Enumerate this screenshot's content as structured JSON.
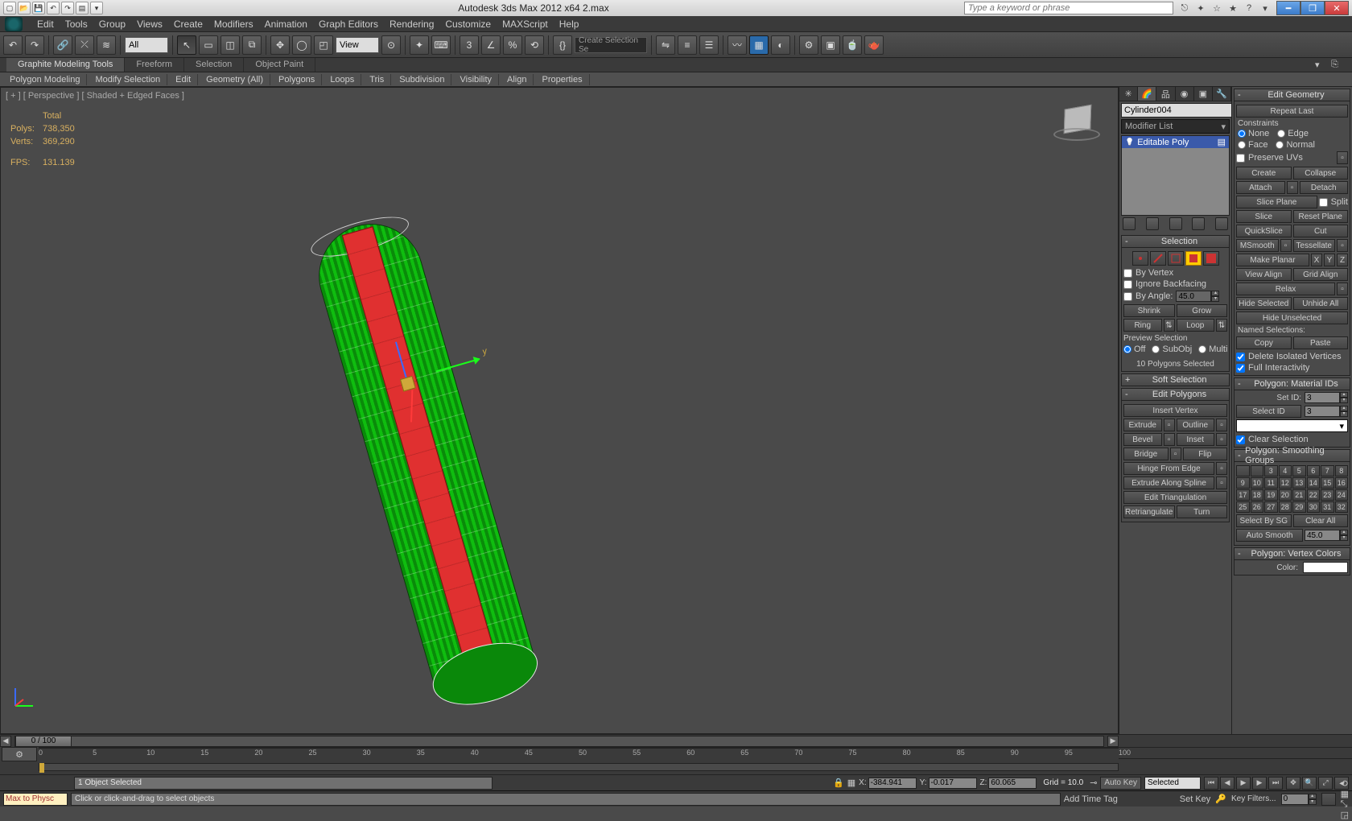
{
  "title": "Autodesk 3ds Max 2012 x64     2.max",
  "searchPlaceholder": "Type a keyword or phrase",
  "menu": [
    "Edit",
    "Tools",
    "Group",
    "Views",
    "Create",
    "Modifiers",
    "Animation",
    "Graph Editors",
    "Rendering",
    "Customize",
    "MAXScript",
    "Help"
  ],
  "maintool": {
    "selSet": "All",
    "refCoord": "View",
    "namedSel": "Create Selection Se"
  },
  "ribbonTabs": [
    "Graphite Modeling Tools",
    "Freeform",
    "Selection",
    "Object Paint"
  ],
  "ribbonSub": [
    "Polygon Modeling",
    "Modify Selection",
    "Edit",
    "Geometry (All)",
    "Polygons",
    "Loops",
    "Tris",
    "Subdivision",
    "Visibility",
    "Align",
    "Properties"
  ],
  "viewport": {
    "label": "[ + ] [ Perspective ] [ Shaded + Edged Faces ]",
    "stats": {
      "totalLabel": "Total",
      "polysLabel": "Polys:",
      "polys": "738,350",
      "vertsLabel": "Verts:",
      "verts": "369,290",
      "fpsLabel": "FPS:",
      "fps": "131.139"
    },
    "axisY": "y"
  },
  "cmd": {
    "objectName": "Cylinder004",
    "modListLabel": "Modifier List",
    "modItem": "Editable Poly",
    "selection": {
      "head": "Selection",
      "byVertex": "By Vertex",
      "ignoreBack": "Ignore Backfacing",
      "byAngle": "By Angle:",
      "angleVal": "45.0",
      "shrink": "Shrink",
      "grow": "Grow",
      "ring": "Ring",
      "loop": "Loop",
      "previewLabel": "Preview Selection",
      "off": "Off",
      "subObj": "SubObj",
      "multi": "Multi",
      "info": "10 Polygons Selected"
    },
    "softSel": "Soft Selection",
    "editPoly": {
      "head": "Edit Polygons",
      "insertVertex": "Insert Vertex",
      "extrude": "Extrude",
      "outline": "Outline",
      "bevel": "Bevel",
      "inset": "Inset",
      "bridge": "Bridge",
      "flip": "Flip",
      "hinge": "Hinge From Edge",
      "extrudeSpline": "Extrude Along Spline",
      "editTri": "Edit Triangulation",
      "retri": "Retriangulate",
      "turn": "Turn"
    }
  },
  "editGeo": {
    "head": "Edit Geometry",
    "repeatLast": "Repeat Last",
    "constraintsLabel": "Constraints",
    "cNone": "None",
    "cEdge": "Edge",
    "cFace": "Face",
    "cNormal": "Normal",
    "preserveUVs": "Preserve UVs",
    "create": "Create",
    "collapse": "Collapse",
    "attach": "Attach",
    "detach": "Detach",
    "slicePlane": "Slice Plane",
    "split": "Split",
    "slice": "Slice",
    "resetPlane": "Reset Plane",
    "quickSlice": "QuickSlice",
    "cut": "Cut",
    "msmooth": "MSmooth",
    "tessellate": "Tessellate",
    "makePlanar": "Make Planar",
    "x": "X",
    "y": "Y",
    "z": "Z",
    "viewAlign": "View Align",
    "gridAlign": "Grid Align",
    "relax": "Relax",
    "hideSel": "Hide Selected",
    "unhideAll": "Unhide All",
    "hideUnsel": "Hide Unselected",
    "namedSelLabel": "Named Selections:",
    "copy": "Copy",
    "paste": "Paste",
    "delIso": "Delete Isolated Vertices",
    "fullInt": "Full Interactivity"
  },
  "matID": {
    "head": "Polygon: Material IDs",
    "setId": "Set ID:",
    "setVal": "3",
    "selId": "Select ID",
    "selVal": "3",
    "clearSel": "Clear Selection"
  },
  "smooth": {
    "head": "Polygon: Smoothing Groups",
    "selectBySG": "Select By SG",
    "clearAll": "Clear All",
    "autoSmooth": "Auto Smooth",
    "autoVal": "45.0"
  },
  "vcolor": {
    "head": "Polygon: Vertex Colors",
    "colorLabel": "Color:"
  },
  "time": {
    "frame": "0 / 100",
    "ticks": [
      0,
      5,
      10,
      15,
      20,
      25,
      30,
      35,
      40,
      45,
      50,
      55,
      60,
      65,
      70,
      75,
      80,
      85,
      90,
      95,
      100
    ]
  },
  "status": {
    "selInfo": "1 Object Selected",
    "x": "-384.941",
    "y": "-0.017",
    "z": "60.065",
    "grid": "Grid = 10.0",
    "autoKey": "Auto Key",
    "selected": "Selected",
    "setKey": "Set Key",
    "keyFilters": "Key Filters...",
    "addTimeTag": "Add Time Tag",
    "script": "Max to Physc",
    "prompt": "Click or click-and-drag to select objects"
  },
  "sg": [
    " ",
    "3",
    "4",
    "5",
    "6",
    "7",
    "8",
    "9",
    "10",
    "11",
    "12",
    "13",
    "14",
    "15",
    "16",
    "17",
    "18",
    "19",
    "20",
    "21",
    "22",
    "23",
    "24",
    "25",
    "26",
    "27",
    "28",
    "29",
    "30",
    "31",
    "32"
  ]
}
